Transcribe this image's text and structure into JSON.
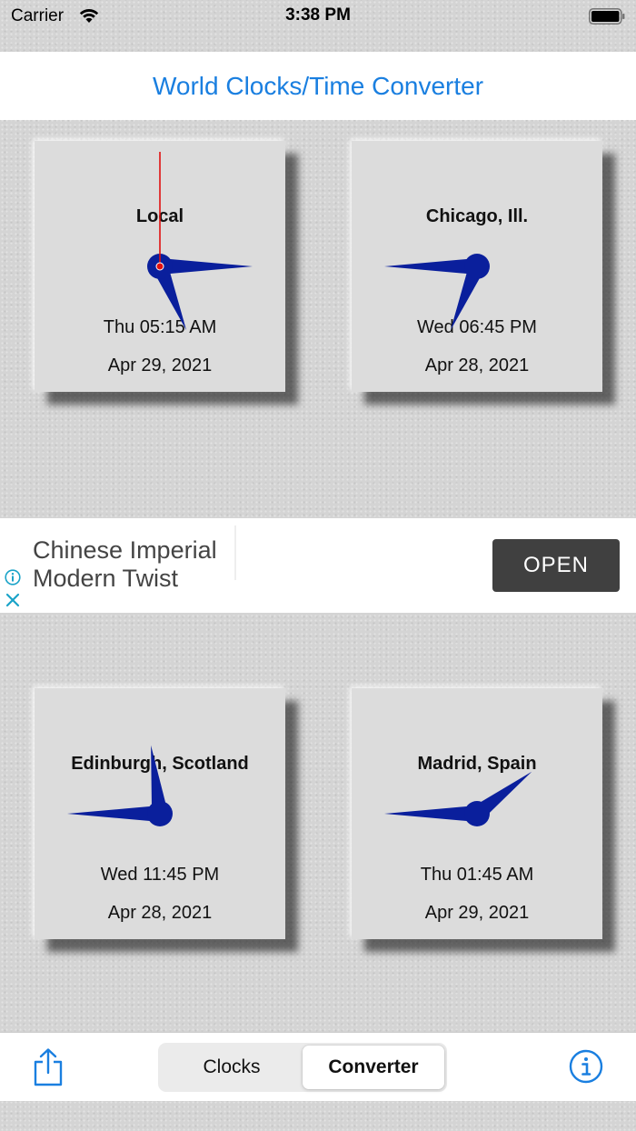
{
  "status_bar": {
    "carrier": "Carrier",
    "time": "3:38 PM"
  },
  "header": {
    "title": "World Clocks/Time Converter"
  },
  "colors": {
    "accent": "#1a7fe0",
    "clock_hand": "#0a1f9c",
    "second_hand": "#e01010"
  },
  "clocks": [
    {
      "city": "Local",
      "day_time": "Thu 05:15 AM",
      "date": "Apr 29, 2021",
      "hours": 5,
      "minutes": 15,
      "seconds": 0,
      "show_second_hand": true
    },
    {
      "city": "Chicago, Ill.",
      "day_time": "Wed 06:45 PM",
      "date": "Apr 28, 2021",
      "hours": 18,
      "minutes": 45,
      "seconds": 0,
      "show_second_hand": false
    },
    {
      "city": "Edinburgh, Scotland",
      "day_time": "Wed 11:45 PM",
      "date": "Apr 28, 2021",
      "hours": 23,
      "minutes": 45,
      "seconds": 0,
      "show_second_hand": false
    },
    {
      "city": "Madrid, Spain",
      "day_time": "Thu 01:45 AM",
      "date": "Apr 29, 2021",
      "hours": 1,
      "minutes": 45,
      "seconds": 0,
      "show_second_hand": false
    }
  ],
  "ad": {
    "line1": "Chinese Imperial",
    "line2": "Modern Twist",
    "button_label": "OPEN"
  },
  "tab_bar": {
    "segments": [
      {
        "label": "Clocks",
        "selected": false
      },
      {
        "label": "Converter",
        "selected": true
      }
    ],
    "left_icon": "share-icon",
    "right_icon": "info-icon"
  }
}
